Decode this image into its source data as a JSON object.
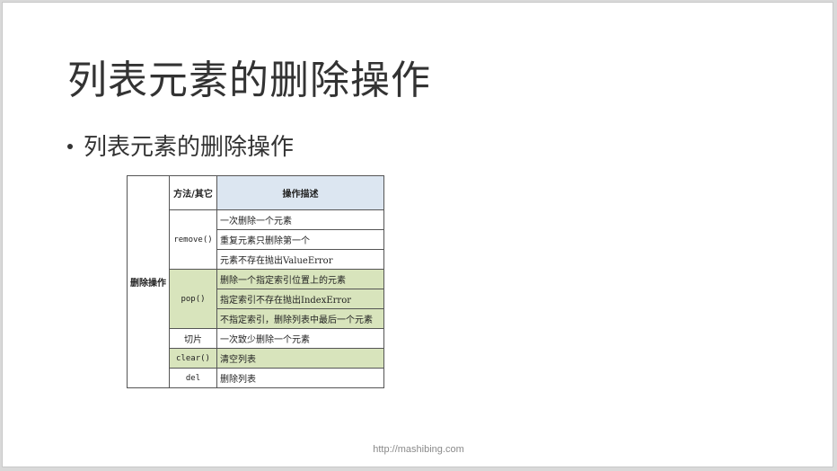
{
  "slide": {
    "title": "列表元素的删除操作",
    "bullet": "列表元素的删除操作",
    "footer_url": "http://mashibing.com"
  },
  "table": {
    "group_label": "删除操作",
    "headers": {
      "method": "方法/其它",
      "description": "操作描述"
    },
    "rows": [
      {
        "method": "remove()",
        "descriptions": [
          "一次删除一个元素",
          "重复元素只删除第一个",
          "元素不存在抛出ValueError"
        ],
        "highlight": false
      },
      {
        "method": "pop()",
        "descriptions": [
          "删除一个指定索引位置上的元素",
          "指定索引不存在抛出IndexError",
          "不指定索引，删除列表中最后一个元素"
        ],
        "highlight": true
      },
      {
        "method": "切片",
        "descriptions": [
          "一次致少删除一个元素"
        ],
        "highlight": false
      },
      {
        "method": "clear()",
        "descriptions": [
          "清空列表"
        ],
        "highlight": true
      },
      {
        "method": "del",
        "descriptions": [
          "删除列表"
        ],
        "highlight": false
      }
    ]
  },
  "colors": {
    "header_blue": "#dce6f1",
    "row_green": "#d8e4bc"
  }
}
